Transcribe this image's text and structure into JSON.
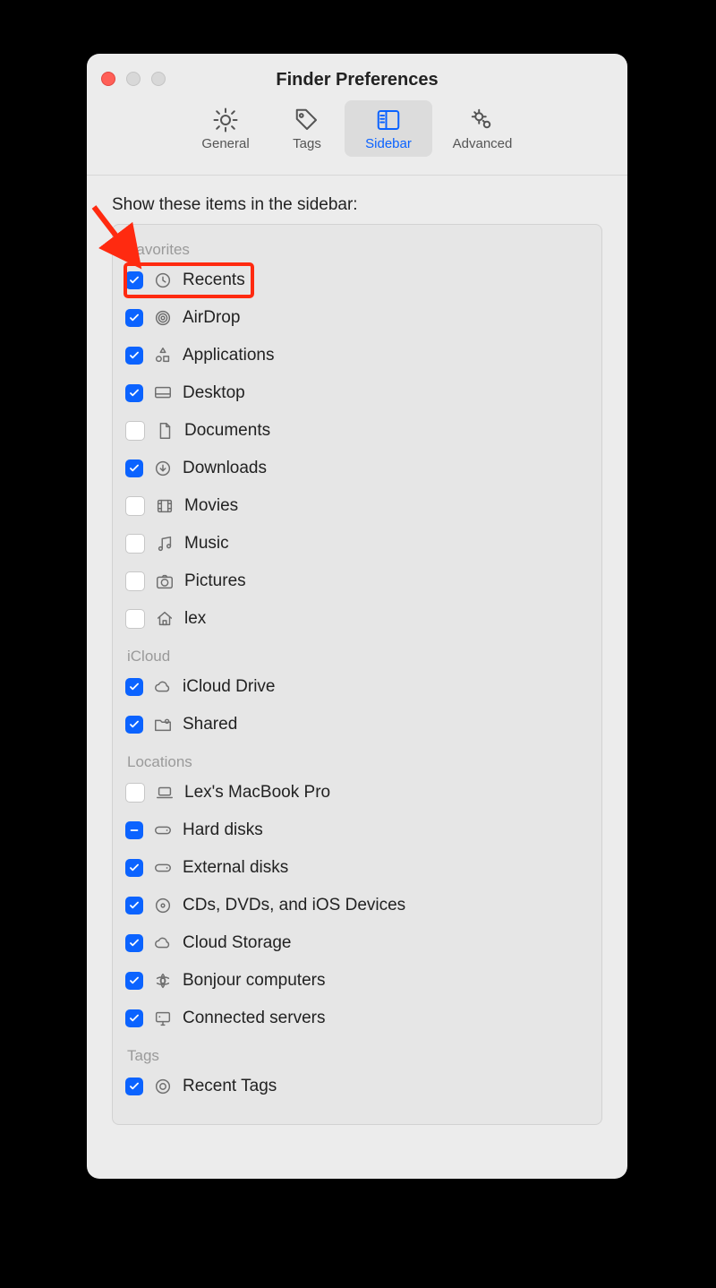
{
  "window": {
    "title": "Finder Preferences"
  },
  "tabs": [
    {
      "id": "general",
      "label": "General",
      "selected": false
    },
    {
      "id": "tags",
      "label": "Tags",
      "selected": false
    },
    {
      "id": "sidebar",
      "label": "Sidebar",
      "selected": true
    },
    {
      "id": "advanced",
      "label": "Advanced",
      "selected": false
    }
  ],
  "heading": "Show these items in the sidebar:",
  "sections": [
    {
      "id": "favorites",
      "title": "Favorites",
      "items": [
        {
          "id": "recents",
          "label": "Recents",
          "checked": true,
          "icon": "clock",
          "highlight": true
        },
        {
          "id": "airdrop",
          "label": "AirDrop",
          "checked": true,
          "icon": "radar"
        },
        {
          "id": "applications",
          "label": "Applications",
          "checked": true,
          "icon": "apps"
        },
        {
          "id": "desktop",
          "label": "Desktop",
          "checked": true,
          "icon": "desktop"
        },
        {
          "id": "documents",
          "label": "Documents",
          "checked": false,
          "icon": "doc"
        },
        {
          "id": "downloads",
          "label": "Downloads",
          "checked": true,
          "icon": "download"
        },
        {
          "id": "movies",
          "label": "Movies",
          "checked": false,
          "icon": "film"
        },
        {
          "id": "music",
          "label": "Music",
          "checked": false,
          "icon": "music"
        },
        {
          "id": "pictures",
          "label": "Pictures",
          "checked": false,
          "icon": "camera"
        },
        {
          "id": "lex",
          "label": "lex",
          "checked": false,
          "icon": "home"
        }
      ]
    },
    {
      "id": "icloud",
      "title": "iCloud",
      "items": [
        {
          "id": "icloud-drive",
          "label": "iCloud Drive",
          "checked": true,
          "icon": "cloud"
        },
        {
          "id": "shared",
          "label": "Shared",
          "checked": true,
          "icon": "folder-shared"
        }
      ]
    },
    {
      "id": "locations",
      "title": "Locations",
      "items": [
        {
          "id": "this-mac",
          "label": "Lex's MacBook Pro",
          "checked": false,
          "icon": "laptop"
        },
        {
          "id": "hard-disks",
          "label": "Hard disks",
          "checked": "mixed",
          "icon": "hdd"
        },
        {
          "id": "ext-disks",
          "label": "External disks",
          "checked": true,
          "icon": "hdd"
        },
        {
          "id": "cds",
          "label": "CDs, DVDs, and iOS Devices",
          "checked": true,
          "icon": "disc"
        },
        {
          "id": "cloud-storage",
          "label": "Cloud Storage",
          "checked": true,
          "icon": "cloud"
        },
        {
          "id": "bonjour",
          "label": "Bonjour computers",
          "checked": true,
          "icon": "bonjour"
        },
        {
          "id": "servers",
          "label": "Connected servers",
          "checked": true,
          "icon": "server"
        }
      ]
    },
    {
      "id": "tags",
      "title": "Tags",
      "items": [
        {
          "id": "recent-tags",
          "label": "Recent Tags",
          "checked": true,
          "icon": "tag-circle"
        }
      ]
    }
  ],
  "annotation": {
    "arrow_color": "#ff2a10",
    "highlight_color": "#ff2a10"
  }
}
